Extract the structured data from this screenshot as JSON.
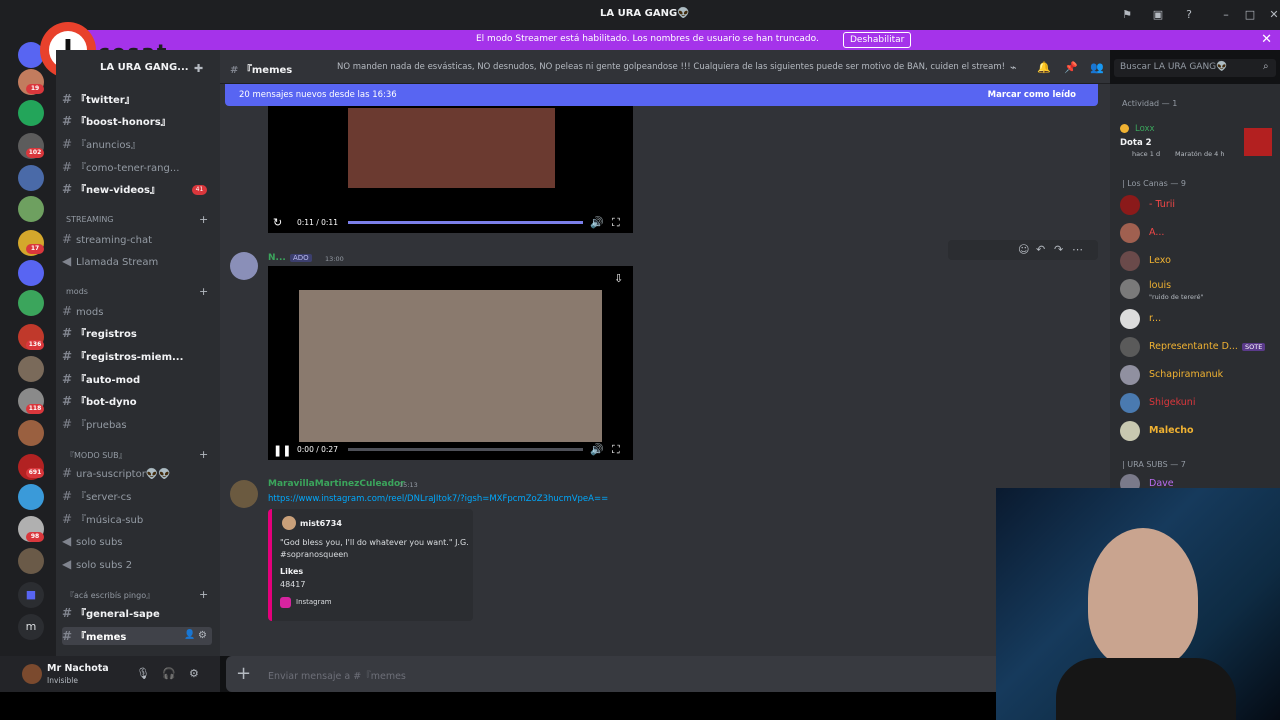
{
  "window": {
    "title": "LA URA GANG👽"
  },
  "banner": {
    "message": "El modo Streamer está habilitado. Los nombres de usuario se han truncado.",
    "button": "Deshabilitar"
  },
  "server": {
    "name": "LA URA GANG...",
    "overlay_text": "cesat"
  },
  "rail_badges": [
    "19",
    "102",
    "17",
    "136",
    "118",
    "691",
    "98"
  ],
  "channels": [
    {
      "name": "『twitter』",
      "unread": true
    },
    {
      "name": "『boost-honors』",
      "unread": true
    },
    {
      "name": "『anuncios』",
      "unread": false
    },
    {
      "name": "『como-tener-rang...",
      "unread": false
    },
    {
      "name": "『new-videos』",
      "unread": true,
      "badge": "41"
    }
  ],
  "categories": {
    "streaming": "STREAMING",
    "mods": "mods",
    "modsub": "『MODO SUB』",
    "aca": "『acá escribís pingo』"
  },
  "streaming_channels": [
    "streaming-chat",
    "Llamada Stream"
  ],
  "mods_channels": [
    "mods",
    "『registros",
    "『registros-miem...",
    "『auto-mod",
    "『bot-dyno",
    "『pruebas"
  ],
  "modsub_channels": [
    "ura-suscriptor👽👽",
    "『server-cs",
    "『música-sub",
    "solo subs",
    "solo subs 2"
  ],
  "aca_channels": [
    "『general-sape",
    "『memes"
  ],
  "user": {
    "name": "Mr Nachota",
    "status": "Invisible"
  },
  "header": {
    "channel": "『memes",
    "topic": "NO manden nada de esvásticas, NO desnudos, NO peleas ni gente golpeandose !!! Cualquiera de las siguientes puede ser motivo de BAN, cuiden el stream!",
    "search_placeholder": "Buscar LA URA GANG👽"
  },
  "new_messages": {
    "text": "20 mensajes nuevos desde las 16:36",
    "mark_read": "Marcar como leído"
  },
  "video1": {
    "time": "0:11 / 0:11",
    "progress": 1.0
  },
  "message1": {
    "author": "N...",
    "tag": "ADO",
    "time": "13:00"
  },
  "video2": {
    "time": "0:00 / 0:27",
    "progress": 0.0
  },
  "message2": {
    "author": "MaravillaMartinezCuleador",
    "time": "15:13",
    "link": "https://www.instagram.com/reel/DNLraJItok7/?igsh=MXFpcmZoZ3hucmVpeA==",
    "embed": {
      "user": "mist6734",
      "text": "\"God bless you, I'll do whatever you want.\" J.G. #sopranosqueen",
      "likes_label": "Likes",
      "likes": "48417",
      "source": "Instagram"
    }
  },
  "composer": {
    "placeholder": "Enviar mensaje a #『memes"
  },
  "members": {
    "activity_header": "Actividad — 1",
    "activity": {
      "name": "Loxx",
      "game": "Dota 2",
      "since": "hace 1 d",
      "detail": "Maratón de 4 h"
    },
    "group1_header": "| Los Canas — 9",
    "group1": [
      {
        "name": "- Turii",
        "color": "#f04747"
      },
      {
        "name": "A...",
        "color": "#f04747"
      },
      {
        "name": "Lexo",
        "color": "#f0b232"
      },
      {
        "name": "louis",
        "color": "#f0b232",
        "sub": "\"ruido de tereré\""
      },
      {
        "name": "r...",
        "color": "#f0b232"
      },
      {
        "name": "Representante D...",
        "color": "#f0b232",
        "tag": "SOTE"
      },
      {
        "name": "Schapiramanuk",
        "color": "#f0b232"
      },
      {
        "name": "Shigekuni",
        "color": "#da373c"
      },
      {
        "name": "Malecho",
        "color": "#f0b232"
      }
    ],
    "group2_header": "| URA SUBS — 7",
    "group2": [
      {
        "name": "Dave",
        "color": "#b96cf0"
      }
    ]
  }
}
